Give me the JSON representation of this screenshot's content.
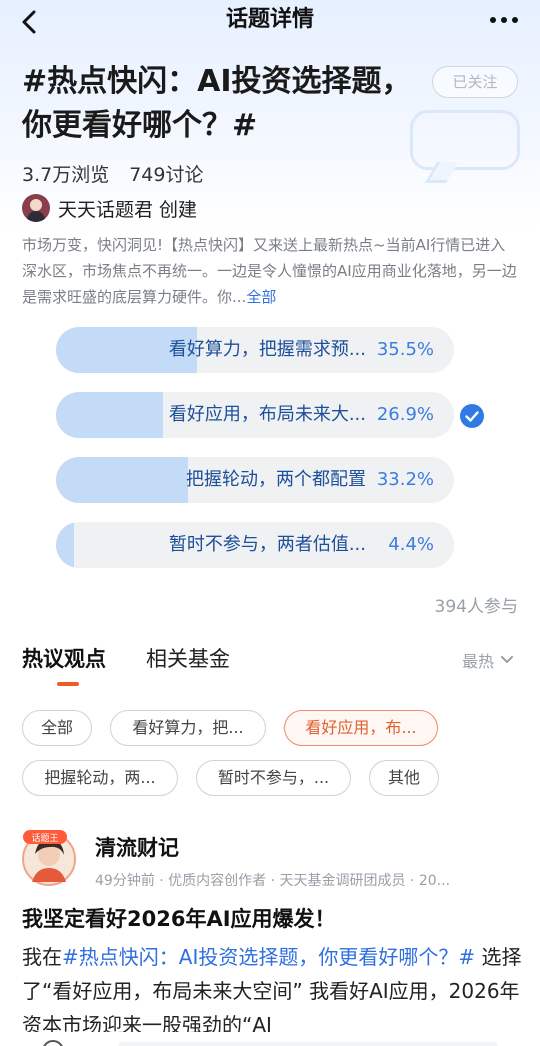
{
  "nav": {
    "title": "话题详情"
  },
  "topic": {
    "title": "#热点快闪：AI投资选择题，你更看好哪个？#",
    "follow_label": "已关注",
    "views": "3.7万浏览",
    "discussions": "749讨论",
    "creator": "天天话题君 创建",
    "description": "市场万变，快闪洞见!【热点快闪】又来送上最新热点~当前AI行情已进入深水区，市场焦点不再统一。一边是令人憧憬的AI应用商业化落地，另一边是需求旺盛的底层算力硬件。你...",
    "more_label": "全部"
  },
  "poll": {
    "options": [
      {
        "label": "看好算力，把握需求预...",
        "percent_label": "35.5%",
        "percent": 35.5,
        "selected": false
      },
      {
        "label": "看好应用，布局未来大...",
        "percent_label": "26.9%",
        "percent": 26.9,
        "selected": true
      },
      {
        "label": "把握轮动，两个都配置",
        "percent_label": "33.2%",
        "percent": 33.2,
        "selected": false
      },
      {
        "label": "暂时不参与，两者估值...",
        "percent_label": "4.4%",
        "percent": 4.4,
        "selected": false
      }
    ],
    "participants": "394人参与"
  },
  "tabs": {
    "active": "热议观点",
    "other": "相关基金",
    "sort": "最热"
  },
  "filters": [
    {
      "label": "全部"
    },
    {
      "label": "看好算力，把..."
    },
    {
      "label": "看好应用，布..."
    },
    {
      "label": "把握轮动，两..."
    },
    {
      "label": "暂时不参与，..."
    },
    {
      "label": "其他"
    }
  ],
  "post": {
    "author": "清流财记",
    "badge": "话题王",
    "meta": "49分钟前 · 优质内容创作者 · 天天基金调研团成员 · 20...",
    "headline": "我坚定看好2026年AI应用爆发！",
    "body_prefix": "我在",
    "body_tag": "#热点快闪：AI投资选择题，你更看好哪个？#",
    "body_suffix": " 选择了“看好应用，布局未来大空间” 我看好AI应用，2026年资本市场迎来一股强劲的“AI"
  },
  "colors": {
    "accent": "#f05a28",
    "link": "#2f6fe0",
    "poll_fill": "#c4dbf7",
    "poll_text": "#1d4f9a"
  }
}
